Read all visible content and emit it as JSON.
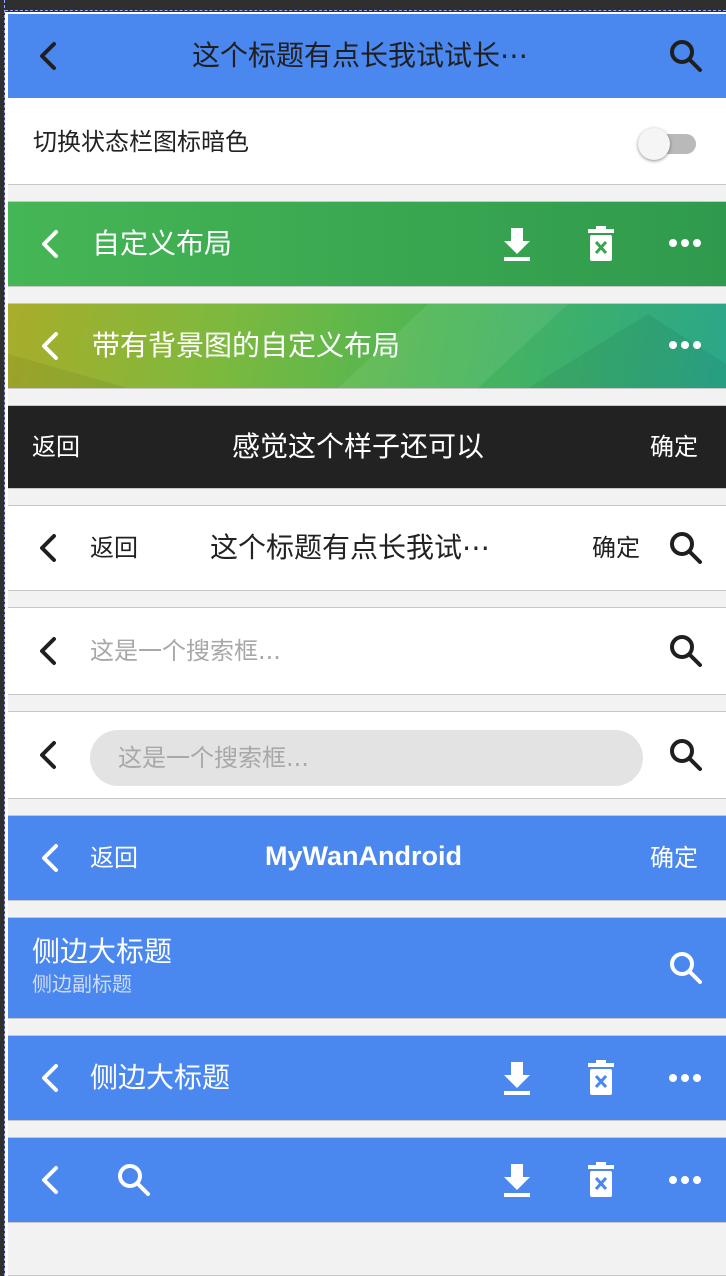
{
  "colors": {
    "primary": "#4a87ef",
    "dark": "#222222",
    "green": "#3aa451"
  },
  "bar1": {
    "title": "这个标题有点长我试试长⋯",
    "back_icon": "chevron-left-icon",
    "search_icon": "search-icon"
  },
  "switch_row": {
    "label": "切换状态栏图标暗色",
    "toggle_state": "off"
  },
  "bar2": {
    "title": "自定义布局",
    "download_icon": "download-icon",
    "delete_icon": "delete-icon",
    "more_icon": "more-icon"
  },
  "bar3": {
    "title": "带有背景图的自定义布局"
  },
  "bar4": {
    "left": "返回",
    "title": "感觉这个样子还可以",
    "right": "确定"
  },
  "bar5": {
    "left": "返回",
    "title": "这个标题有点长我试⋯",
    "right": "确定"
  },
  "bar6": {
    "placeholder": "这是一个搜索框..."
  },
  "bar7": {
    "placeholder": "这是一个搜索框..."
  },
  "bar8": {
    "left": "返回",
    "title": "MyWanAndroid",
    "right": "确定"
  },
  "bar9": {
    "title": "侧边大标题",
    "subtitle": "侧边副标题"
  },
  "bar10": {
    "title": "侧边大标题"
  }
}
